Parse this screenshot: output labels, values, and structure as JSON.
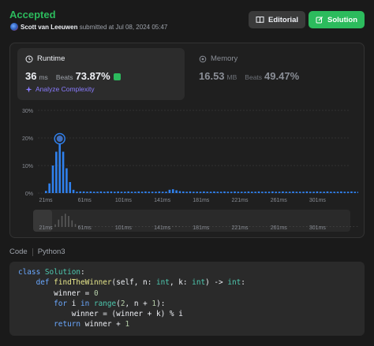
{
  "header": {
    "status": "Accepted",
    "username": "Scott van Leeuwen",
    "submitted_text": "submitted at Jul 08, 2024 05:47",
    "editorial_label": "Editorial",
    "solution_label": "Solution"
  },
  "runtime": {
    "title": "Runtime",
    "value": "36",
    "unit": "ms",
    "beats_label": "Beats",
    "beats_pct": "73.87%",
    "analyze_label": "Analyze Complexity"
  },
  "memory": {
    "title": "Memory",
    "value": "16.53",
    "unit": "MB",
    "beats_label": "Beats",
    "beats_pct": "49.47%"
  },
  "chart_data": {
    "type": "bar",
    "y_ticks": [
      "30%",
      "20%",
      "10%",
      "0%"
    ],
    "ylim": [
      0,
      30
    ],
    "x_ticks": [
      "21ms",
      "61ms",
      "101ms",
      "141ms",
      "181ms",
      "221ms",
      "261ms",
      "301ms"
    ],
    "x_start_ms": 21,
    "values": [
      0.8,
      3.5,
      10,
      15,
      18,
      15,
      9,
      4,
      1.2,
      0.5,
      0.6,
      0.6,
      0.5,
      0.6,
      0.5,
      0.5,
      0.6,
      0.5,
      0.6,
      0.6,
      0.5,
      0.6,
      0.5,
      0.5,
      0.6,
      0.5,
      0.5,
      0.6,
      0.5,
      0.6,
      0.5,
      0.5,
      0.5,
      0.6,
      0.5,
      0.5,
      1.2,
      1.4,
      1.0,
      0.7,
      0.6,
      0.5,
      0.6,
      0.5,
      0.5,
      0.5,
      0.6,
      0.5,
      0.5,
      0.6,
      0.5,
      0.5,
      0.6,
      0.5,
      0.5,
      0.6,
      0.5,
      0.5,
      0.5,
      0.6,
      0.5,
      0.5,
      0.6,
      0.5,
      0.5,
      0.5,
      0.6,
      0.5,
      0.5,
      0.6,
      0.5,
      0.5,
      0.6,
      0.5,
      0.5,
      0.5,
      0.6,
      0.5,
      0.5,
      0.6,
      0.5,
      0.5,
      0.6,
      0.5,
      0.5,
      0.5,
      0.6,
      0.5,
      0.5,
      0.6,
      0.5,
      0.5
    ],
    "highlight_index": 4,
    "bar_color": "#2f80ed",
    "grid": true
  },
  "code": {
    "tab_label": "Code",
    "language": "Python3",
    "lines": [
      "class Solution:",
      "    def findTheWinner(self, n: int, k: int) -> int:",
      "        winner = 0",
      "        for i in range(2, n + 1):",
      "            winner = (winner + k) % i",
      "        return winner + 1"
    ]
  },
  "colors": {
    "accent_green": "#2cbb5d",
    "analyze_purple": "#8a7cff",
    "bar_blue": "#2f80ed"
  }
}
